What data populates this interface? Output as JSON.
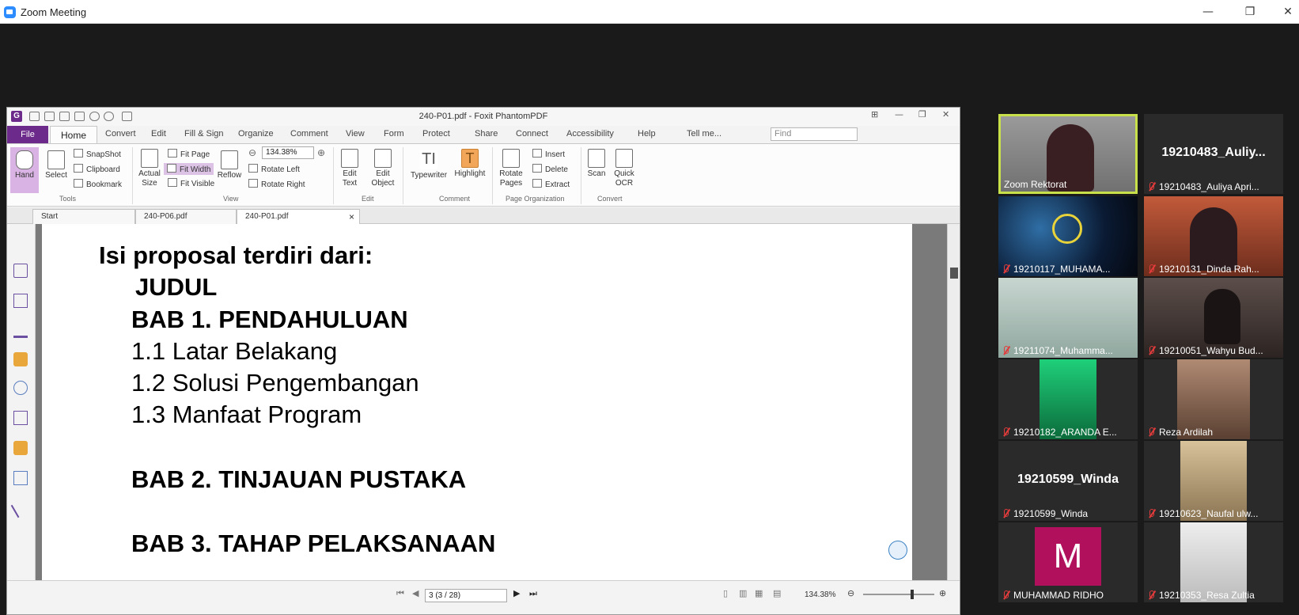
{
  "window": {
    "title": "Zoom Meeting",
    "minimize_glyph": "—",
    "maximize_glyph": "❐",
    "close_glyph": "✕"
  },
  "foxit": {
    "logo_letter": "G",
    "doc_title": "240-P01.pdf - Foxit PhantomPDF",
    "menu": {
      "file": "File",
      "home": "Home",
      "convert": "Convert",
      "edit": "Edit",
      "fill_sign": "Fill & Sign",
      "organize": "Organize",
      "comment": "Comment",
      "view": "View",
      "form": "Form",
      "protect": "Protect",
      "share": "Share",
      "connect": "Connect",
      "accessibility": "Accessibility",
      "help": "Help",
      "tell_me": "Tell me...",
      "find_placeholder": "Find"
    },
    "ribbon": {
      "hand": "Hand",
      "select": "Select",
      "snapshot": "SnapShot",
      "clipboard": "Clipboard",
      "bookmark": "Bookmark",
      "tools_group": "Tools",
      "actual_size": "Actual Size",
      "fit_page": "Fit Page",
      "fit_width": "Fit Width",
      "fit_visible": "Fit Visible",
      "reflow": "Reflow",
      "zoom": "134.38%",
      "rotate_left": "Rotate Left",
      "rotate_right": "Rotate Right",
      "view_group": "View",
      "edit_text": "Edit Text",
      "edit_object": "Edit Object",
      "edit_group": "Edit",
      "typewriter": "Typewriter",
      "highlight": "Highlight",
      "comment_group": "Comment",
      "rotate_pages": "Rotate Pages",
      "insert": "Insert",
      "delete": "Delete",
      "extract": "Extract",
      "page_org_group": "Page Organization",
      "scan": "Scan",
      "quick_ocr": "Quick OCR",
      "convert_group": "Convert"
    },
    "tabs": {
      "start": "Start",
      "tab2": "240-P06.pdf",
      "tab3": "240-P01.pdf",
      "close_glyph": "×"
    },
    "page": {
      "heading": "Isi proposal terdiri dari:",
      "judul": "JUDUL",
      "bab1": "BAB 1. PENDAHULUAN",
      "s11": "1.1 Latar Belakang",
      "s12": "1.2 Solusi Pengembangan",
      "s13": "1.3 Manfaat Program",
      "bab2": "BAB 2. TINJAUAN PUSTAKA",
      "bab3": "BAB 3. TAHAP PELAKSANAAN"
    },
    "status": {
      "page_field": "3 (3 / 28)",
      "zoom": "134.38%"
    }
  },
  "participants": [
    {
      "label": "Zoom Rektorat",
      "video": true,
      "active": true
    },
    {
      "label": "19210483_Auliya Apri...",
      "display": "19210483_Auliy...",
      "video": false,
      "muted": true
    },
    {
      "label": "19210117_MUHAMA...",
      "video": true,
      "muted": true
    },
    {
      "label": "19210131_Dinda Rah...",
      "video": true,
      "muted": true
    },
    {
      "label": "19211074_Muhamma...",
      "video": true,
      "muted": true
    },
    {
      "label": "19210051_Wahyu Bud...",
      "video": true,
      "muted": true
    },
    {
      "label": "19210182_ARANDA E...",
      "video": true,
      "muted": true
    },
    {
      "label": "Reza Ardilah",
      "video": true,
      "muted": true
    },
    {
      "label": "19210599_Winda",
      "display": "19210599_Winda",
      "video": false,
      "muted": true
    },
    {
      "label": "19210623_Naufal ulw...",
      "video": true,
      "muted": true
    },
    {
      "label": "MUHAMMAD RIDHO",
      "avatar_letter": "M",
      "avatar_color": "#b0105c",
      "video": false,
      "muted": true
    },
    {
      "label": "19210353_Resa Zultia",
      "video": true,
      "muted": true
    }
  ],
  "colors": {
    "foxit_purple": "#6c2a8a",
    "active_speaker": "#c8e04a",
    "mute_red": "#e23b3b"
  }
}
